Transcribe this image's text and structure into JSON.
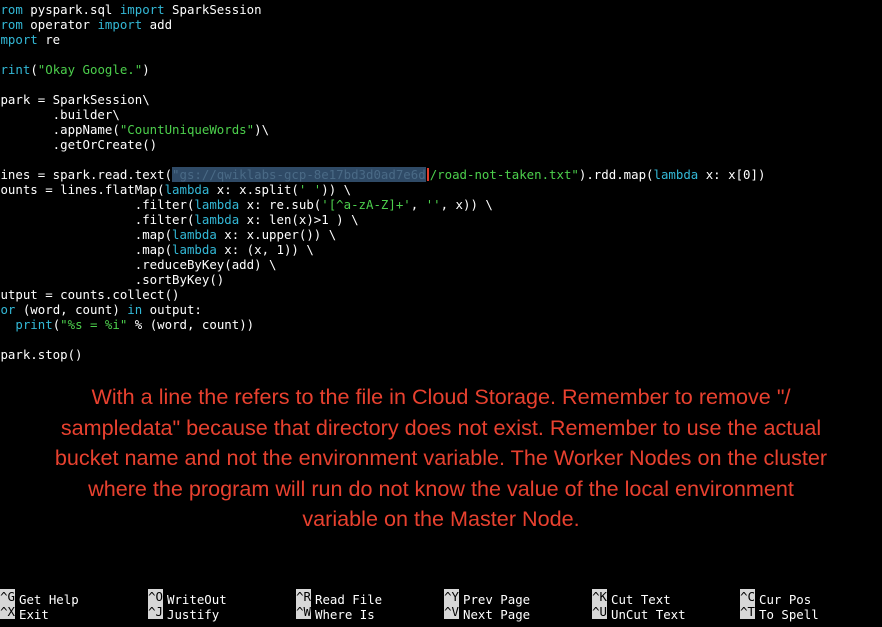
{
  "editor": {
    "lines": [
      [
        {
          "t": "from",
          "c": "kw"
        },
        {
          "t": " pyspark.sql "
        },
        {
          "t": "import",
          "c": "kw"
        },
        {
          "t": " SparkSession"
        }
      ],
      [
        {
          "t": "from",
          "c": "kw"
        },
        {
          "t": " operator "
        },
        {
          "t": "import",
          "c": "kw"
        },
        {
          "t": " add"
        }
      ],
      [
        {
          "t": "import",
          "c": "kw"
        },
        {
          "t": " re"
        }
      ],
      [],
      [
        {
          "t": "print",
          "c": "kw"
        },
        {
          "t": "("
        },
        {
          "t": "\"Okay Google.\"",
          "c": "str"
        },
        {
          "t": ")"
        }
      ],
      [],
      [
        {
          "t": "spark = SparkSession\\"
        }
      ],
      [
        {
          "t": "        .builder\\"
        }
      ],
      [
        {
          "t": "        .appName("
        },
        {
          "t": "\"CountUniqueWords\"",
          "c": "str"
        },
        {
          "t": ")\\"
        }
      ],
      [
        {
          "t": "        .getOrCreate()"
        }
      ],
      [],
      [
        {
          "t": "lines = spark.read.text("
        },
        {
          "t": "\"gs://qwiklabs-gcp-8e17bd3d0ad7e6d",
          "c": "sel"
        },
        {
          "t": "",
          "c": "caret"
        },
        {
          "t": "/road-not-taken.txt\"",
          "c": "str"
        },
        {
          "t": ").rdd.map("
        },
        {
          "t": "lambda",
          "c": "kw"
        },
        {
          "t": " x: x[0])"
        }
      ],
      [
        {
          "t": "counts = lines.flatMap("
        },
        {
          "t": "lambda",
          "c": "kw"
        },
        {
          "t": " x: x.split("
        },
        {
          "t": "' '",
          "c": "str"
        },
        {
          "t": ")) \\"
        }
      ],
      [
        {
          "t": "                   .filter("
        },
        {
          "t": "lambda",
          "c": "kw"
        },
        {
          "t": " x: re.sub("
        },
        {
          "t": "'[^a-zA-Z]+'",
          "c": "str"
        },
        {
          "t": ", "
        },
        {
          "t": "''",
          "c": "str"
        },
        {
          "t": ", x)) \\"
        }
      ],
      [
        {
          "t": "                   .filter("
        },
        {
          "t": "lambda",
          "c": "kw"
        },
        {
          "t": " x: len(x)>1 ) \\"
        }
      ],
      [
        {
          "t": "                   .map("
        },
        {
          "t": "lambda",
          "c": "kw"
        },
        {
          "t": " x: x.upper()) \\"
        }
      ],
      [
        {
          "t": "                   .map("
        },
        {
          "t": "lambda",
          "c": "kw"
        },
        {
          "t": " x: (x, 1)) \\"
        }
      ],
      [
        {
          "t": "                   .reduceByKey(add) \\"
        }
      ],
      [
        {
          "t": "                   .sortByKey()"
        }
      ],
      [
        {
          "t": "output = counts.collect()"
        }
      ],
      [
        {
          "t": "for",
          "c": "kw"
        },
        {
          "t": " (word, count) "
        },
        {
          "t": "in",
          "c": "kw"
        },
        {
          "t": " output:"
        }
      ],
      [
        {
          "t": "   "
        },
        {
          "t": "print",
          "c": "kw"
        },
        {
          "t": "("
        },
        {
          "t": "\"%s = %i\"",
          "c": "str"
        },
        {
          "t": " % (word, count))"
        }
      ],
      [],
      [
        {
          "t": "spark.stop()"
        }
      ]
    ]
  },
  "annotation": {
    "lines": [
      "With a line the refers to the file in Cloud Storage. Remember to remove \"/",
      "sampledata\" because that directory does not exist. Remember to use the actual",
      "bucket name and not the environment variable. The Worker Nodes on the cluster",
      "where the program will run do not know the value of the local environment",
      "variable on the Master Node."
    ],
    "color": "#e8412f"
  },
  "shortcuts": {
    "row1": [
      {
        "key": "^G",
        "label": "Get Help",
        "icon": "get-help"
      },
      {
        "key": "^O",
        "label": "WriteOut",
        "icon": "write-out"
      },
      {
        "key": "^R",
        "label": "Read File",
        "icon": "read-file"
      },
      {
        "key": "^Y",
        "label": "Prev Page",
        "icon": "prev-page"
      },
      {
        "key": "^K",
        "label": "Cut Text",
        "icon": "cut-text"
      },
      {
        "key": "^C",
        "label": "Cur Pos",
        "icon": "cur-pos"
      }
    ],
    "row2": [
      {
        "key": "^X",
        "label": "Exit",
        "icon": "exit"
      },
      {
        "key": "^J",
        "label": "Justify",
        "icon": "justify"
      },
      {
        "key": "^W",
        "label": "Where Is",
        "icon": "where-is"
      },
      {
        "key": "^V",
        "label": "Next Page",
        "icon": "next-page"
      },
      {
        "key": "^U",
        "label": "UnCut Text",
        "icon": "uncut-text"
      },
      {
        "key": "^T",
        "label": "To Spell",
        "icon": "to-spell"
      }
    ]
  },
  "colors": {
    "background": "#000000",
    "text": "#ffffff",
    "keyword": "#33b8d6",
    "string": "#4ccf4c",
    "selection_bg": "#2f4a66",
    "annotation": "#e8412f"
  }
}
